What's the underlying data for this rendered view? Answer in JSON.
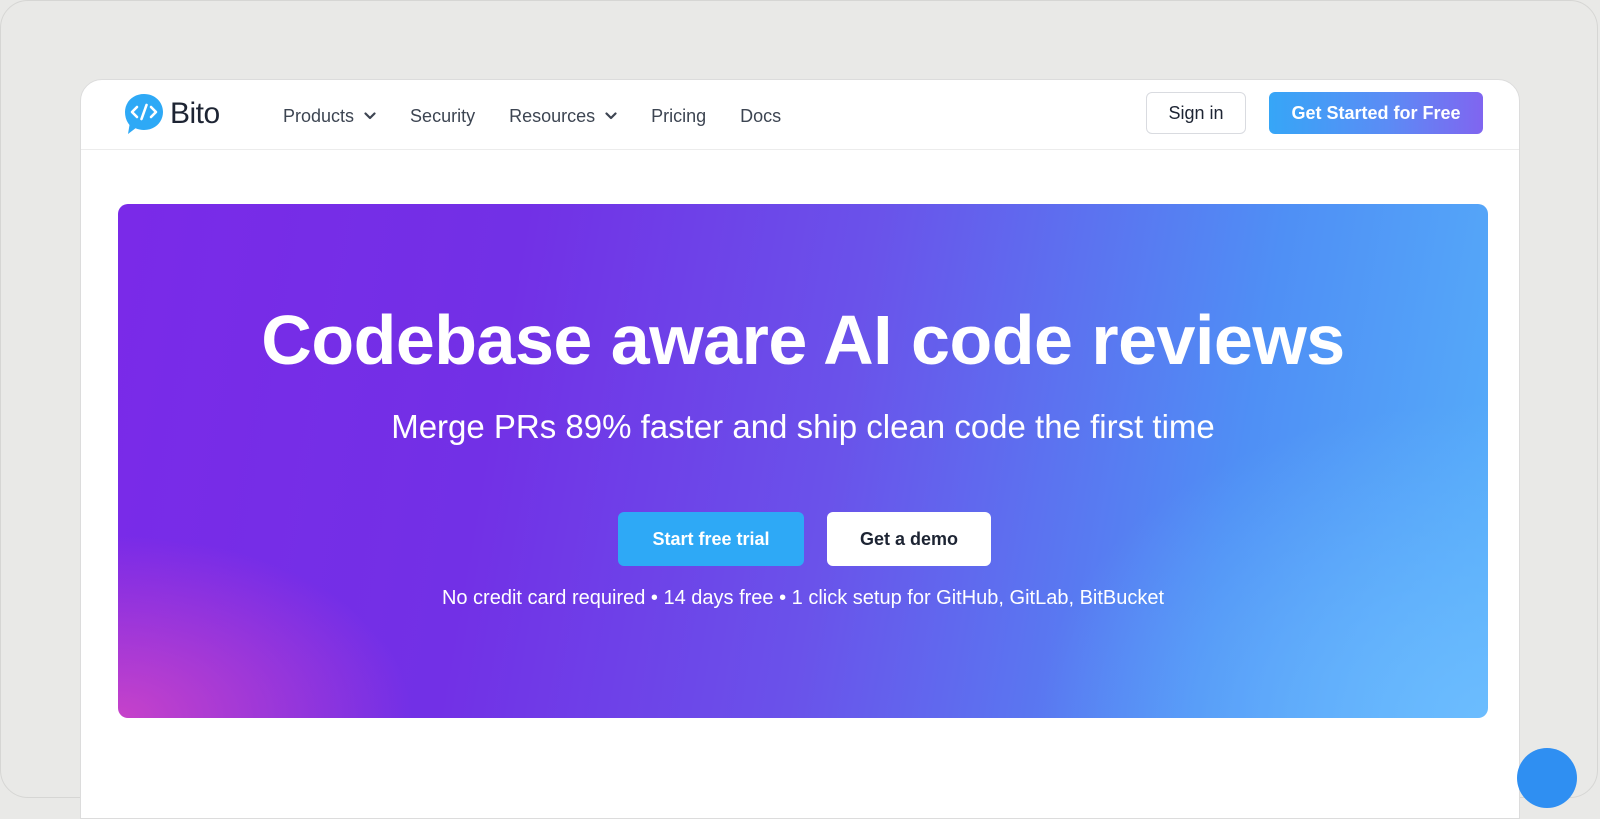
{
  "brand": {
    "name": "Bito",
    "accent": "#2ea9f6"
  },
  "nav": {
    "items": [
      {
        "label": "Products",
        "has_dropdown": true
      },
      {
        "label": "Security",
        "has_dropdown": false
      },
      {
        "label": "Resources",
        "has_dropdown": true
      },
      {
        "label": "Pricing",
        "has_dropdown": false
      },
      {
        "label": "Docs",
        "has_dropdown": false
      }
    ],
    "sign_in": "Sign in",
    "get_started": "Get Started for Free"
  },
  "hero": {
    "title": "Codebase aware AI code reviews",
    "subtitle": "Merge PRs 89% faster and ship clean code the first time",
    "primary_cta": "Start free trial",
    "secondary_cta": "Get a demo",
    "note": "No credit card required • 14 days free • 1 click setup for GitHub, GitLab, BitBucket"
  }
}
